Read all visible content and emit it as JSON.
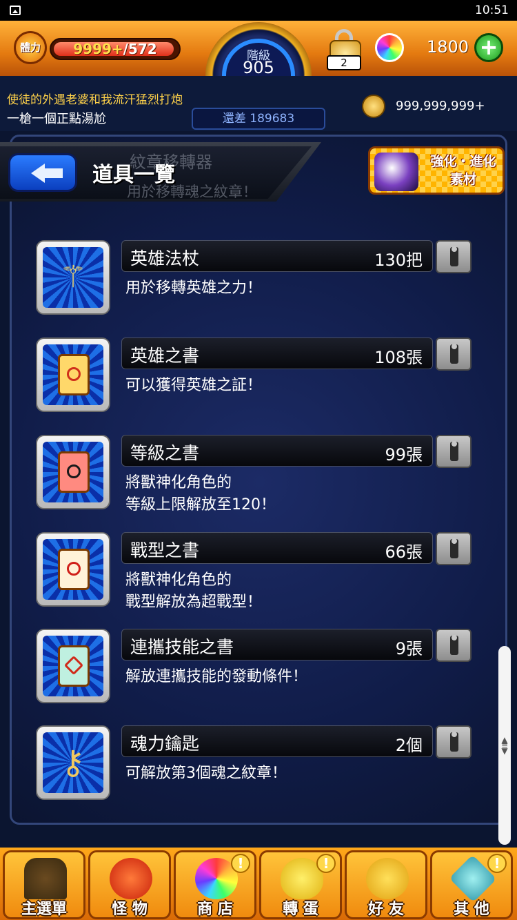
{
  "status_bar": {
    "time": "10:51"
  },
  "top_bar": {
    "stamina_label": "體力",
    "stamina_current": "9999+",
    "stamina_max": "/572",
    "rank_label": "階級",
    "rank_value": "905",
    "lock_count": "2",
    "orb_count": "1800",
    "remaining_exp": "還差 189683",
    "gold_count": "999,999,999+"
  },
  "ticker": {
    "line1": "使徒的外遇老婆和我流汗猛烈打炮",
    "line2": "一槍一個正點湯尬"
  },
  "header": {
    "title": "道具一覽",
    "ghost_item_name": "紋章移轉器",
    "ghost_item_desc": "用於移轉魂之紋章！",
    "promo_line1": "強化・進化",
    "promo_line2": "素材"
  },
  "items": [
    {
      "name": "英雄法杖",
      "count": "130把",
      "desc": "用於移轉英雄之力！",
      "icon": "staff-icon"
    },
    {
      "name": "英雄之書",
      "count": "108張",
      "desc": "可以獲得英雄之証！",
      "icon": "hero-scroll-icon"
    },
    {
      "name": "等級之書",
      "count": "99張",
      "desc": "將獸神化角色的\n等級上限解放至120！",
      "icon": "level-scroll-icon"
    },
    {
      "name": "戰型之書",
      "count": "66張",
      "desc": "將獸神化角色的\n戰型解放為超戰型！",
      "icon": "battle-type-scroll-icon"
    },
    {
      "name": "連攜技能之書",
      "count": "9張",
      "desc": "解放連攜技能的發動條件！",
      "icon": "combo-skill-scroll-icon"
    },
    {
      "name": "魂力鑰匙",
      "count": "2個",
      "desc": "可解放第3個魂之紋章！",
      "icon": "soul-key-icon"
    }
  ],
  "bottom_nav": [
    {
      "label": "主選單",
      "icon": "home-gate-icon",
      "alert": false
    },
    {
      "label": "怪 物",
      "icon": "monster-icon",
      "alert": false
    },
    {
      "label": "商 店",
      "icon": "rainbow-orb-icon",
      "alert": true
    },
    {
      "label": "轉 蛋",
      "icon": "gacha-egg-icon",
      "alert": true
    },
    {
      "label": "好 友",
      "icon": "friends-balloon-icon",
      "alert": false
    },
    {
      "label": "其 他",
      "icon": "question-sign-icon",
      "alert": true
    }
  ],
  "colors": {
    "accent_orange": "#f08a0e",
    "panel_blue": "#101c48",
    "rank_ring_blue": "#2a8cff"
  }
}
